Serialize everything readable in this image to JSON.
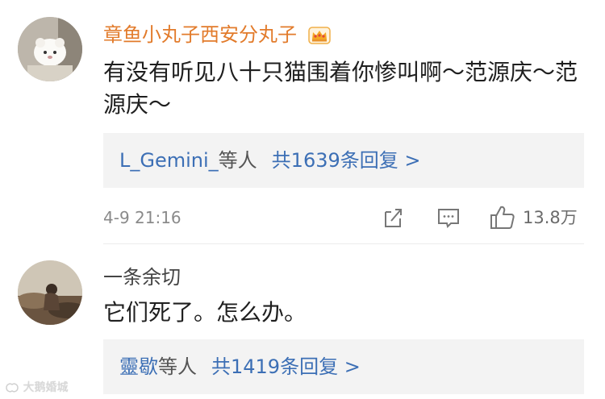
{
  "comments": [
    {
      "username": "章鱼小丸子西安分丸子",
      "badge_icon": "crown-vip-icon",
      "text": "有没有听见八十只猫围着你惨叫啊～范源庆～范源庆～",
      "replies": {
        "names": "L_Gemini_",
        "suffix": "等人",
        "count_text": "共1639条回复 >"
      },
      "date": "4-9 21:16",
      "actions": {
        "share_icon": "share-icon",
        "comment_icon": "comment-icon",
        "like_icon": "thumbs-up-icon",
        "like_count": "13.8万"
      }
    },
    {
      "username": "一条余切",
      "text": "它们死了。怎么办。",
      "replies": {
        "names": "靈歇",
        "suffix": "等人",
        "count_text": "共1419条回复 >"
      }
    }
  ],
  "watermark": {
    "text": "大鹅婚城"
  },
  "colors": {
    "vip_username": "#e27b2b",
    "reply_link": "#3c6fb5",
    "reply_bg": "#f3f3f3"
  }
}
